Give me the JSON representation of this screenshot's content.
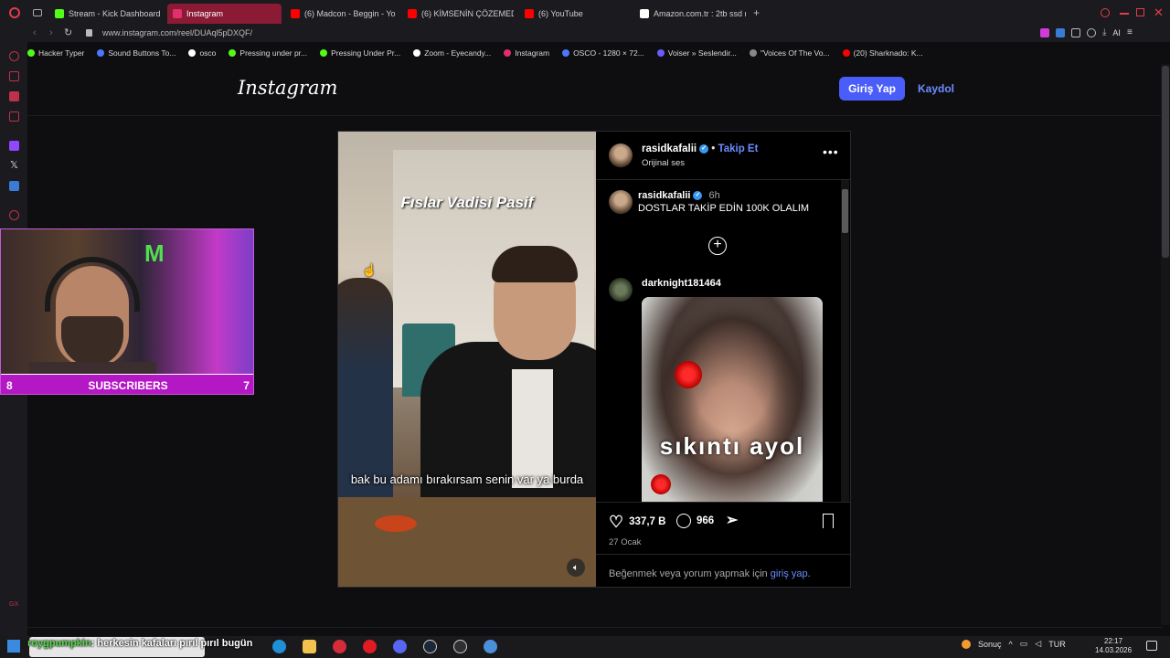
{
  "browser": {
    "tabs": [
      {
        "label": "Stream - Kick Dashboard",
        "color": "#53fc18"
      },
      {
        "label": "Instagram",
        "color": "#e1306c",
        "active": true
      },
      {
        "label": "(6) Madcon - Beggin - Yo",
        "color": "#ff0000"
      },
      {
        "label": "(6) KİMSENİN ÇÖZEMEDİ",
        "color": "#ff0000"
      },
      {
        "label": "(6) YouTube",
        "color": "#ff0000"
      },
      {
        "label": "Amazon.com.tr : 2tb ssd m",
        "color": "#ffffff"
      }
    ],
    "new_tab": "+",
    "url": "www.instagram.com/reel/DUAql5pDXQF/",
    "bookmarks": [
      {
        "label": "Hacker Typer",
        "color": "#53fc18"
      },
      {
        "label": "Sound Buttons To...",
        "color": "#4a78ff"
      },
      {
        "label": "osco",
        "color": "#ffffff"
      },
      {
        "label": "Pressing under pr...",
        "color": "#53fc18"
      },
      {
        "label": "Pressing Under Pr...",
        "color": "#53fc18"
      },
      {
        "label": "Zoom - Eyecandy...",
        "color": "#ffffff"
      },
      {
        "label": "Instagram",
        "color": "#e1306c"
      },
      {
        "label": "OSCO - 1280 × 72...",
        "color": "#4a78ff"
      },
      {
        "label": "Voiser » Seslendir...",
        "color": "#6a5cff"
      },
      {
        "label": "\"Voices Of The Vo...",
        "color": "#888888"
      },
      {
        "label": "(20) Sharknado: K...",
        "color": "#ff0000"
      }
    ]
  },
  "instagram": {
    "logo": "Instagram",
    "login_button": "Giriş Yap",
    "signup_link": "Kaydol"
  },
  "post": {
    "video_title": "Fıslar Vadisi Pasif",
    "video_caption": "bak bu adamı bırakırsam senin var ya burda",
    "author": "rasidkafalii",
    "follow_separator": "•",
    "follow": "Takip Et",
    "audio": "Orijinal ses",
    "more": "•••",
    "comments": [
      {
        "user": "rasidkafalii",
        "time": "6h",
        "text": "DOSTLAR TAKİP EDİN 100K OLALIM"
      },
      {
        "user": "darknight181464",
        "image_caption": "sıkıntı ayol"
      }
    ],
    "load_more": "+",
    "likes": "337,7 B",
    "comment_count": "966",
    "date": "27 Ocak",
    "login_prompt": "Beğenmek veya yorum yapmak için",
    "login_link": "giriş yap",
    "login_suffix": "."
  },
  "webcam": {
    "label": "SUBSCRIBERS",
    "left_count": "8",
    "right_count": "7"
  },
  "taskbar": {
    "chat_user": "roygpumpkin",
    "chat_message": ": herkesin kafaları pırıl pırıl bugün",
    "weather_label": "Sonuç",
    "language": "TUR",
    "time": "22:17",
    "date": "14.03.2026"
  }
}
